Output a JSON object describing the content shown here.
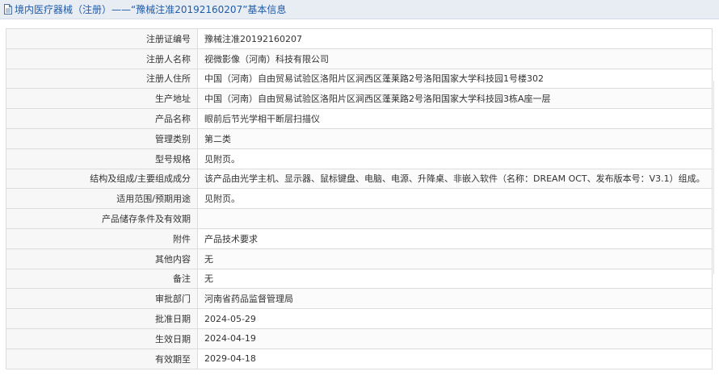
{
  "header": {
    "title": "境内医疗器械（注册）——“豫械注准20192160207”基本信息",
    "icon": "document-icon"
  },
  "rows": [
    {
      "label": "注册证编号",
      "value": "豫械注准20192160207"
    },
    {
      "label": "注册人名称",
      "value": "视微影像（河南）科技有限公司"
    },
    {
      "label": "注册人住所",
      "value": "中国（河南）自由贸易试验区洛阳片区涧西区蓬莱路2号洛阳国家大学科技园1号楼302"
    },
    {
      "label": "生产地址",
      "value": "中国（河南）自由贸易试验区洛阳片区涧西区蓬莱路2号洛阳国家大学科技园3栋A座一层"
    },
    {
      "label": "产品名称",
      "value": "眼前后节光学相干断层扫描仪"
    },
    {
      "label": "管理类别",
      "value": "第二类"
    },
    {
      "label": "型号规格",
      "value": "见附页。"
    },
    {
      "label": "结构及组成/主要组成成分",
      "value": "该产品由光学主机、显示器、鼠标键盘、电脑、电源、升降桌、非嵌入软件（名称：DREAM OCT、发布版本号：V3.1）组成。"
    },
    {
      "label": "适用范围/预期用途",
      "value": "见附页。"
    },
    {
      "label": "产品储存条件及有效期",
      "value": ""
    },
    {
      "label": "附件",
      "value": "产品技术要求"
    },
    {
      "label": "其他内容",
      "value": "无"
    },
    {
      "label": "备注",
      "value": "无"
    },
    {
      "label": "审批部门",
      "value": "河南省药品监督管理局"
    },
    {
      "label": "批准日期",
      "value": "2024-05-29"
    },
    {
      "label": "生效日期",
      "value": "2024-04-19"
    },
    {
      "label": "有效期至",
      "value": "2029-04-18"
    }
  ],
  "colors": {
    "title": "#1f5ba8",
    "header_bg": "#e8edf4",
    "border": "#dcdcdc"
  }
}
